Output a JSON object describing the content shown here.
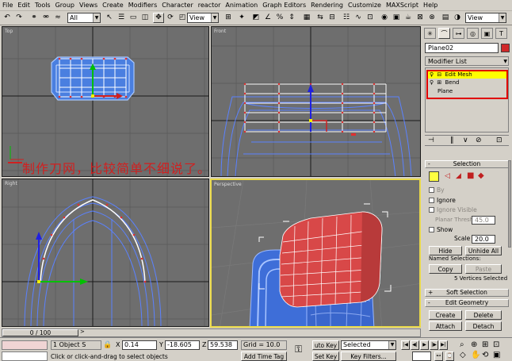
{
  "menu": [
    "File",
    "Edit",
    "Tools",
    "Group",
    "Views",
    "Create",
    "Modifiers",
    "Character",
    "reactor",
    "Animation",
    "Graph Editors",
    "Rendering",
    "Customize",
    "MAXScript",
    "Help"
  ],
  "toolbar": {
    "filter_value": "All",
    "refcoord_value": "View",
    "view_right": "View"
  },
  "viewports": {
    "top": "Top",
    "front": "Front",
    "left": "Right",
    "perspective": "Perspective"
  },
  "caption": "制作刀网，比较简单不细说了。",
  "panel": {
    "tabs": [
      "create-tab-icon",
      "modify-tab-icon",
      "hierarchy-tab-icon",
      "motion-tab-icon",
      "display-tab-icon",
      "utilities-tab-icon"
    ],
    "object_name": "Plane02",
    "object_color": "#d02828",
    "modifier_list": "Modifier List",
    "stack": [
      "Edit Mesh",
      "Bend",
      "Plane"
    ],
    "selection": {
      "title": "Selection",
      "by": "By",
      "ignore": "Ignore",
      "ignore_visible": "Ignore Visible",
      "planar_label": "Planar Thresh",
      "planar_value": "45.0",
      "show": "Show",
      "scale_label": "Scale",
      "scale_value": "20.0",
      "hide": "Hide",
      "unhide_all": "Unhide All",
      "named_label": "Named Selections:",
      "copy": "Copy",
      "paste": "Paste",
      "status": "5 Vertices Selected"
    },
    "soft_selection": "Soft Selection",
    "edit_geometry": {
      "title": "Edit Geometry",
      "create": "Create",
      "delete": "Delete",
      "attach": "Attach",
      "detach": "Detach"
    }
  },
  "timeline": {
    "frame": "0 / 100"
  },
  "status": {
    "selected_count": "1 Object S",
    "x_label": "X",
    "x_value": "0.14",
    "y_label": "Y",
    "y_value": "-18.605",
    "z_label": "Z",
    "z_value": "59.538",
    "grid": "Grid = 10.0",
    "autokey": "uto Key",
    "selected_dropdown": "Selected",
    "setkey": "Set Key",
    "keyfilters": "Key Filters...",
    "prompt": "Click or click-and-drag to select objects",
    "add_time_tag": "Add Time Tag"
  }
}
